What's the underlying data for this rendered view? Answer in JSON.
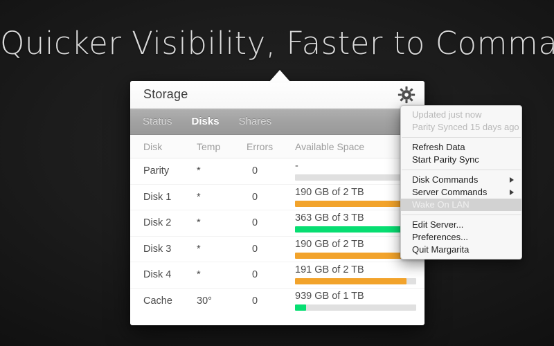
{
  "headline": "Quicker Visibility, Faster to Command",
  "colors": {
    "background": "#1c1c1c",
    "accent_orange": "#F2A32B",
    "accent_green": "#07DE72",
    "track_grey": "#E0E0E0",
    "tabbar_grey": "#A2A2A2",
    "highlight_grey": "#D2D2D2"
  },
  "popover": {
    "title": "Storage",
    "gear_icon": "gear-icon",
    "tabs": [
      {
        "label": "Status",
        "active": false
      },
      {
        "label": "Disks",
        "active": true
      },
      {
        "label": "Shares",
        "active": false
      }
    ],
    "table": {
      "columns": [
        "Disk",
        "Temp",
        "Errors",
        "Available Space"
      ],
      "rows": [
        {
          "disk": "Parity",
          "temp": "*",
          "errors": "0",
          "space": "-",
          "fill_pct": 0,
          "color": "#E0E0E0"
        },
        {
          "disk": "Disk 1",
          "temp": "*",
          "errors": "0",
          "space": "190 GB of 2 TB",
          "fill_pct": 97,
          "color": "#F2A32B"
        },
        {
          "disk": "Disk 2",
          "temp": "*",
          "errors": "0",
          "space": "363 GB of 3 TB",
          "fill_pct": 92,
          "color": "#07DE72"
        },
        {
          "disk": "Disk 3",
          "temp": "*",
          "errors": "0",
          "space": "190 GB of 2 TB",
          "fill_pct": 97,
          "color": "#F2A32B"
        },
        {
          "disk": "Disk 4",
          "temp": "*",
          "errors": "0",
          "space": "191 GB of 2 TB",
          "fill_pct": 92,
          "color": "#F2A32B"
        },
        {
          "disk": "Cache",
          "temp": "30°",
          "errors": "0",
          "space": "939 GB of 1 TB",
          "fill_pct": 9,
          "color": "#07DE72"
        }
      ]
    }
  },
  "menu": {
    "groups": [
      [
        {
          "label": "Updated just now",
          "state": "disabled"
        },
        {
          "label": "Parity Synced 15 days ago",
          "state": "disabled"
        }
      ],
      [
        {
          "label": "Refresh Data",
          "state": "normal"
        },
        {
          "label": "Start Parity Sync",
          "state": "normal"
        }
      ],
      [
        {
          "label": "Disk Commands",
          "state": "normal",
          "submenu": true
        },
        {
          "label": "Server Commands",
          "state": "normal",
          "submenu": true
        },
        {
          "label": "Wake On LAN",
          "state": "highlight"
        }
      ],
      [
        {
          "label": "Edit Server...",
          "state": "normal"
        },
        {
          "label": "Preferences...",
          "state": "normal"
        },
        {
          "label": "Quit Margarita",
          "state": "normal"
        }
      ]
    ]
  }
}
